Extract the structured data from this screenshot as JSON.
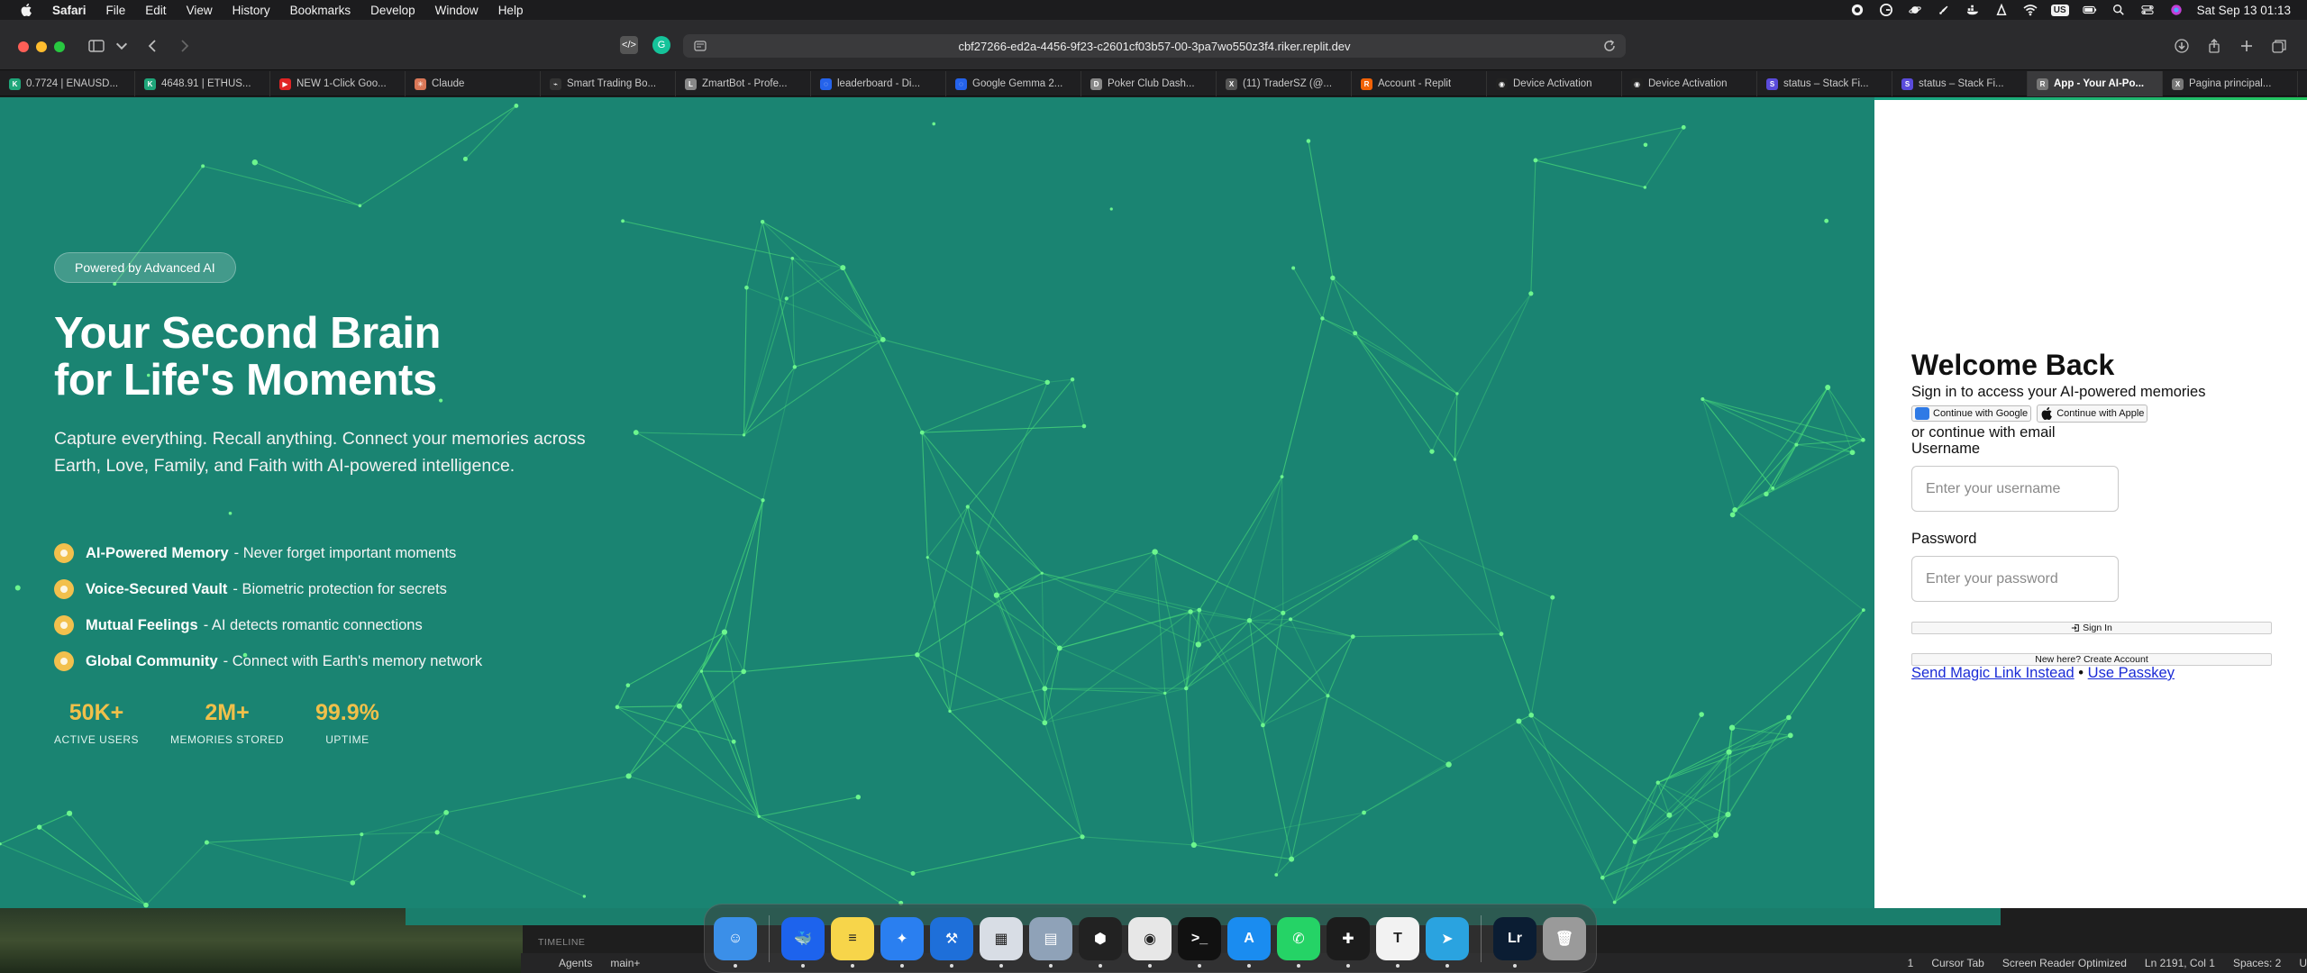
{
  "menubar": {
    "app_name": "Safari",
    "items": [
      "File",
      "Edit",
      "View",
      "History",
      "Bookmarks",
      "Develop",
      "Window",
      "Help"
    ],
    "keyboard_layout": "US",
    "clock": "Sat Sep 13  01:13"
  },
  "toolbar": {
    "url": "cbf27266-ed2a-4456-9f23-c2601cf03b57-00-3pa7wo550z3f4.riker.replit.dev"
  },
  "tabs": [
    {
      "label": "0.7724 | ENAUSD...",
      "icon_color": "#1fa67a",
      "icon_text": "K"
    },
    {
      "label": "4648.91 | ETHUS...",
      "icon_color": "#1fa67a",
      "icon_text": "K"
    },
    {
      "label": "NEW 1-Click Goo...",
      "icon_color": "#e02424",
      "icon_text": "▶"
    },
    {
      "label": "Claude",
      "icon_color": "#d97757",
      "icon_text": "✳"
    },
    {
      "label": "Smart Trading Bo...",
      "icon_color": "#333333",
      "icon_text": "⌁"
    },
    {
      "label": "ZmartBot - Profe...",
      "icon_color": "#888888",
      "icon_text": "L"
    },
    {
      "label": "leaderboard - Di...",
      "icon_color": "#2563eb",
      "icon_text": "◌"
    },
    {
      "label": "Google Gemma 2...",
      "icon_color": "#2563eb",
      "icon_text": "◌"
    },
    {
      "label": "Poker Club Dash...",
      "icon_color": "#888888",
      "icon_text": "D"
    },
    {
      "label": "(11) TraderSZ (@...",
      "icon_color": "#555555",
      "icon_text": "X"
    },
    {
      "label": "Account - Replit",
      "icon_color": "#f26207",
      "icon_text": "R"
    },
    {
      "label": "Device Activation",
      "icon_color": "#222222",
      "icon_text": "◉"
    },
    {
      "label": "Device Activation",
      "icon_color": "#222222",
      "icon_text": "◉"
    },
    {
      "label": "status – Stack Fi...",
      "icon_color": "#5a4bdb",
      "icon_text": "S"
    },
    {
      "label": "status – Stack Fi...",
      "icon_color": "#5a4bdb",
      "icon_text": "S"
    },
    {
      "label": "App - Your AI-Po...",
      "icon_color": "#777777",
      "icon_text": "R",
      "active": true
    },
    {
      "label": "Pagina principal...",
      "icon_color": "#777777",
      "icon_text": "X"
    }
  ],
  "hero": {
    "badge": "Powered by Advanced AI",
    "title_line1": "Your Second Brain",
    "title_line2": "for Life's Moments",
    "description": "Capture everything. Recall anything. Connect your memories across Earth, Love, Family, and Faith with AI-powered intelligence.",
    "features": [
      {
        "title": "AI-Powered Memory",
        "text": "- Never forget important moments"
      },
      {
        "title": "Voice-Secured Vault",
        "text": "- Biometric protection for secrets"
      },
      {
        "title": "Mutual Feelings",
        "text": "- AI detects romantic connections"
      },
      {
        "title": "Global Community",
        "text": "- Connect with Earth's memory network"
      }
    ],
    "stats": [
      {
        "value": "50K+",
        "label": "ACTIVE USERS"
      },
      {
        "value": "2M+",
        "label": "MEMORIES STORED"
      },
      {
        "value": "99.9%",
        "label": "UPTIME"
      }
    ],
    "background_color": "#1a8472",
    "accent_color": "#f0c04a"
  },
  "login": {
    "heading": "Welcome Back",
    "subtitle": "Sign in to access your AI-powered memories",
    "google_label": "Continue with Google",
    "apple_label": "Continue with Apple",
    "divider_text": "or continue with email",
    "username_label": "Username",
    "username_placeholder": "Enter your username",
    "password_label": "Password",
    "password_placeholder": "Enter your password",
    "sign_in_label": "Sign In",
    "create_account_label": "New here? Create Account",
    "magic_link_label": "Send Magic Link Instead",
    "separator": "•",
    "passkey_label": "Use Passkey"
  },
  "ide": {
    "timeline_label": "TIMELINE",
    "agents_label": "Agents",
    "branch_label": "main+",
    "status_items": [
      "1",
      "Cursor Tab",
      "Screen Reader Optimized",
      "Ln 2191, Col 1",
      "Spaces: 2",
      "U"
    ]
  },
  "dock": {
    "apps": [
      {
        "name": "finder",
        "color": "#3b8fe8",
        "glyph": "☺",
        "running": true
      },
      {
        "name": "docker",
        "color": "#1d63ed",
        "glyph": "🐳",
        "running": true
      },
      {
        "name": "notes",
        "color": "#f7d54a",
        "glyph": "≡",
        "running": true
      },
      {
        "name": "safari",
        "color": "#2a7ff0",
        "glyph": "✦",
        "running": true
      },
      {
        "name": "xcode",
        "color": "#1e6fd9",
        "glyph": "⚒",
        "running": true
      },
      {
        "name": "preview",
        "color": "#d8dde5",
        "glyph": "▦",
        "running": true
      },
      {
        "name": "photo-app",
        "color": "#8fa2b8",
        "glyph": "▤",
        "running": true
      },
      {
        "name": "cube-app",
        "color": "#222222",
        "glyph": "⬢",
        "running": true
      },
      {
        "name": "chrome",
        "color": "#e7e7e7",
        "glyph": "◉",
        "running": true
      },
      {
        "name": "terminal",
        "color": "#111111",
        "glyph": ">_",
        "running": true
      },
      {
        "name": "app-store",
        "color": "#1a8cf0",
        "glyph": "A",
        "running": true
      },
      {
        "name": "whatsapp",
        "color": "#25d366",
        "glyph": "✆",
        "running": true
      },
      {
        "name": "tradeapp",
        "color": "#1c1c1c",
        "glyph": "✚",
        "running": true
      },
      {
        "name": "typora",
        "color": "#f2f2f2",
        "glyph": "T",
        "running": true
      },
      {
        "name": "telegram",
        "color": "#2aa3e0",
        "glyph": "➤",
        "running": true
      },
      {
        "name": "lightroom",
        "color": "#0b1d33",
        "glyph": "Lr",
        "running": true
      },
      {
        "name": "trash",
        "color": "#9a9a9a",
        "glyph": "🗑",
        "running": false
      }
    ]
  }
}
